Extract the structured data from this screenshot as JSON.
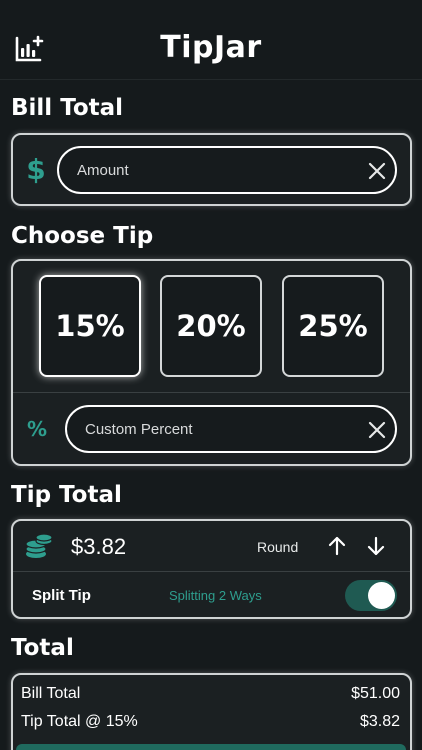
{
  "app": {
    "title": "TipJar",
    "accent_color": "#2e9e8e"
  },
  "header": {
    "stats_icon": "chart-add-icon"
  },
  "bill": {
    "section_title": "Bill Total",
    "currency_symbol": "$",
    "amount_placeholder": "Amount",
    "clear_icon": "close-icon"
  },
  "tip": {
    "section_title": "Choose Tip",
    "options": [
      "15%",
      "20%",
      "25%"
    ],
    "selected_index": 0,
    "custom_symbol": "%",
    "custom_placeholder": "Custom Percent"
  },
  "tip_total": {
    "section_title": "Tip Total",
    "coins_icon": "coins-icon",
    "amount": "$3.82",
    "round_label": "Round",
    "split_label": "Split Tip",
    "split_status": "Splitting 2 Ways",
    "split_enabled": true
  },
  "total": {
    "section_title": "Total",
    "rows": [
      {
        "label": "Bill Total",
        "value": "$51.00"
      },
      {
        "label": "Tip Total @ 15%",
        "value": "$3.82"
      }
    ]
  }
}
